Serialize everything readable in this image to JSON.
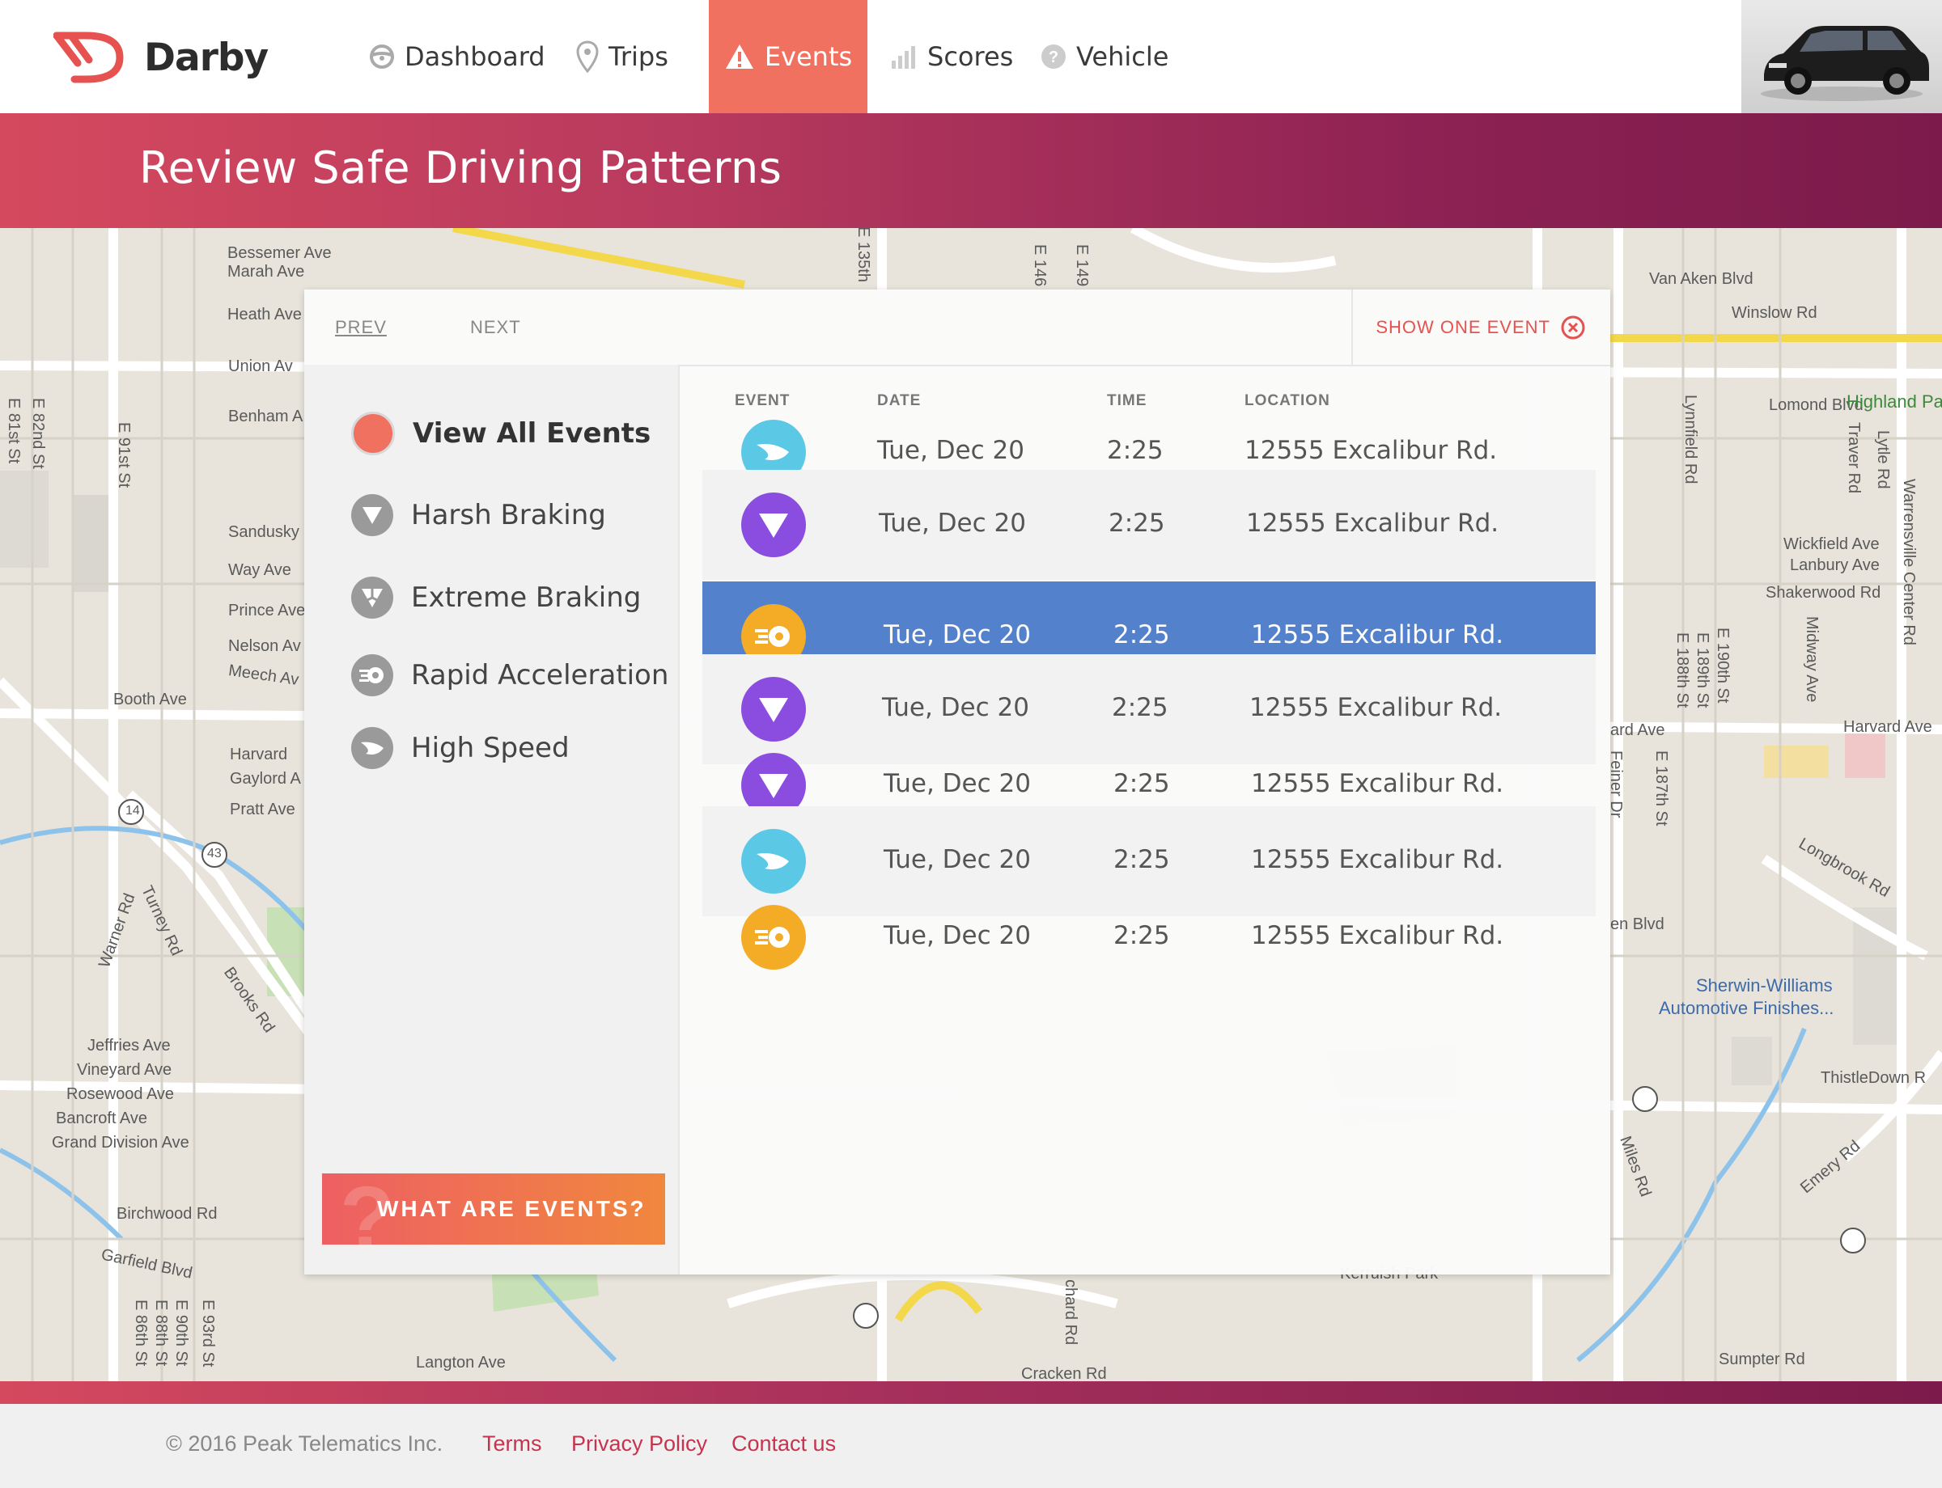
{
  "header": {
    "brand": "Darby",
    "nav": [
      {
        "label": "Dashboard",
        "icon": "steering-wheel-icon"
      },
      {
        "label": "Trips",
        "icon": "map-pin-icon"
      },
      {
        "label": "Events",
        "icon": "warning-icon",
        "active": true
      },
      {
        "label": "Scores",
        "icon": "bar-chart-icon"
      },
      {
        "label": "Vehicle",
        "icon": "question-icon"
      }
    ]
  },
  "banner": {
    "title": "Review Safe Driving Patterns"
  },
  "panel": {
    "prev": "PREV",
    "next": "NEXT",
    "show_one": "SHOW ONE EVENT",
    "filters": [
      {
        "label": "View All Events",
        "icon": "all-events-dot-icon"
      },
      {
        "label": "Harsh Braking",
        "icon": "harsh-braking-icon"
      },
      {
        "label": "Extreme Braking",
        "icon": "extreme-braking-icon"
      },
      {
        "label": "Rapid Acceleration",
        "icon": "rapid-acceleration-icon"
      },
      {
        "label": "High Speed",
        "icon": "high-speed-icon"
      }
    ],
    "what_are_events": "WHAT ARE EVENTS?",
    "columns": {
      "event": "EVENT",
      "date": "DATE",
      "time": "TIME",
      "location": "LOCATION"
    },
    "rows": [
      {
        "type": "high-speed",
        "date": "Tue, Dec 20",
        "time": "2:25",
        "location": "12555 Excalibur Rd."
      },
      {
        "type": "harsh-braking",
        "date": "Tue, Dec 20",
        "time": "2:25",
        "location": "12555 Excalibur Rd."
      },
      {
        "type": "rapid-acceleration",
        "date": "Tue, Dec 20",
        "time": "2:25",
        "location": "12555 Excalibur Rd.",
        "selected": true
      },
      {
        "type": "harsh-braking",
        "date": "Tue, Dec 20",
        "time": "2:25",
        "location": "12555 Excalibur Rd."
      },
      {
        "type": "harsh-braking",
        "date": "Tue, Dec 20",
        "time": "2:25",
        "location": "12555 Excalibur Rd."
      },
      {
        "type": "high-speed",
        "date": "Tue, Dec 20",
        "time": "2:25",
        "location": "12555 Excalibur Rd."
      },
      {
        "type": "rapid-acceleration",
        "date": "Tue, Dec 20",
        "time": "2:25",
        "location": "12555 Excalibur Rd."
      }
    ]
  },
  "map": {
    "labels": [
      "Bessemer Ave",
      "Marah Ave",
      "Heath Ave",
      "Union Av",
      "Benham A",
      "Sandusky",
      "Way Ave",
      "Prince Ave",
      "Nelson Av",
      "Meech Av",
      "Booth Ave",
      "Harvard",
      "Gaylord A",
      "Pratt Ave",
      "E 91st St",
      "E 82nd St",
      "E 81st St",
      "Warner Rd",
      "Turney Rd",
      "Brooks Rd",
      "Jeffries Ave",
      "Vineyard Ave",
      "Rosewood Ave",
      "Bancroft Ave",
      "Grand Division Ave",
      "Birchwood Rd",
      "Garfield Blvd",
      "E 86th St",
      "E 88th St",
      "E 90th St",
      "E 93rd St",
      "Langton Ave",
      "Van Aken Blvd",
      "Winslow Rd",
      "Lomond Blvd",
      "Highland Pa",
      "Lynnfield Rd",
      "Traver Rd",
      "Lytle Rd",
      "Wickfield Ave",
      "Lanbury Ave",
      "Shakerwood Rd",
      "Warrensville Center Rd",
      "Midway Ave",
      "E 188th St",
      "E 189th St",
      "E 190th St",
      "Harvard Ave",
      "ard Ave",
      "Feiner Dr",
      "E 187th St",
      "Longbrook Rd",
      "en Blvd",
      "Sherwin-Williams",
      "Automotive Finishes...",
      "ThistleDown R",
      "Emery Rd",
      "Miles Rd",
      "Sumpter Rd",
      "Kerruish Park",
      "chard Rd",
      "Cracken Rd",
      "E 135th",
      "E 146",
      "E 149",
      "14",
      "43"
    ]
  },
  "footer": {
    "copyright": "© 2016  Peak Telematics Inc.",
    "terms": "Terms",
    "privacy": "Privacy Policy",
    "contact": "Contact us"
  }
}
